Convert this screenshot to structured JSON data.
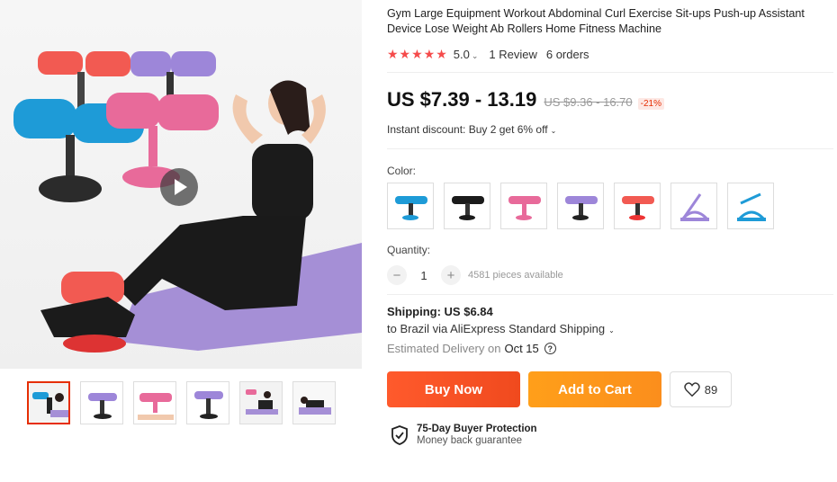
{
  "product": {
    "title": "Gym Large Equipment Workout Abdominal Curl Exercise Sit-ups Push-up Assistant Device Lose Weight Ab Rollers Home Fitness Machine",
    "rating_stars": "★★★★★",
    "rating_value": "5.0",
    "reviews": "1 Review",
    "orders": "6 orders"
  },
  "price": {
    "current": "US $7.39 - 13.19",
    "original": "US $9.36 - 16.70",
    "discount": "-21%",
    "instant_discount": "Instant discount: Buy 2 get 6% off"
  },
  "color": {
    "label": "Color:",
    "options": [
      "blue",
      "black",
      "pink",
      "purple",
      "red",
      "purple-pull-rope",
      "blue-pull-rope"
    ]
  },
  "quantity": {
    "label": "Quantity:",
    "value": "1",
    "minus": "−",
    "plus": "+",
    "available": "4581 pieces available"
  },
  "shipping": {
    "cost": "Shipping: US $6.84",
    "to": "to Brazil via AliExpress Standard Shipping",
    "estimated_label": "Estimated Delivery on",
    "estimated_date": "Oct 15"
  },
  "actions": {
    "buy_now": "Buy Now",
    "add_to_cart": "Add to Cart",
    "wishlist_count": "89"
  },
  "protection": {
    "title": "75-Day Buyer Protection",
    "subtitle": "Money back guarantee"
  },
  "colors": {
    "accent": "#e62e04",
    "buy_button": "#f54a1e",
    "cart_button": "#fb9b1b",
    "stars": "#f54b4b"
  }
}
